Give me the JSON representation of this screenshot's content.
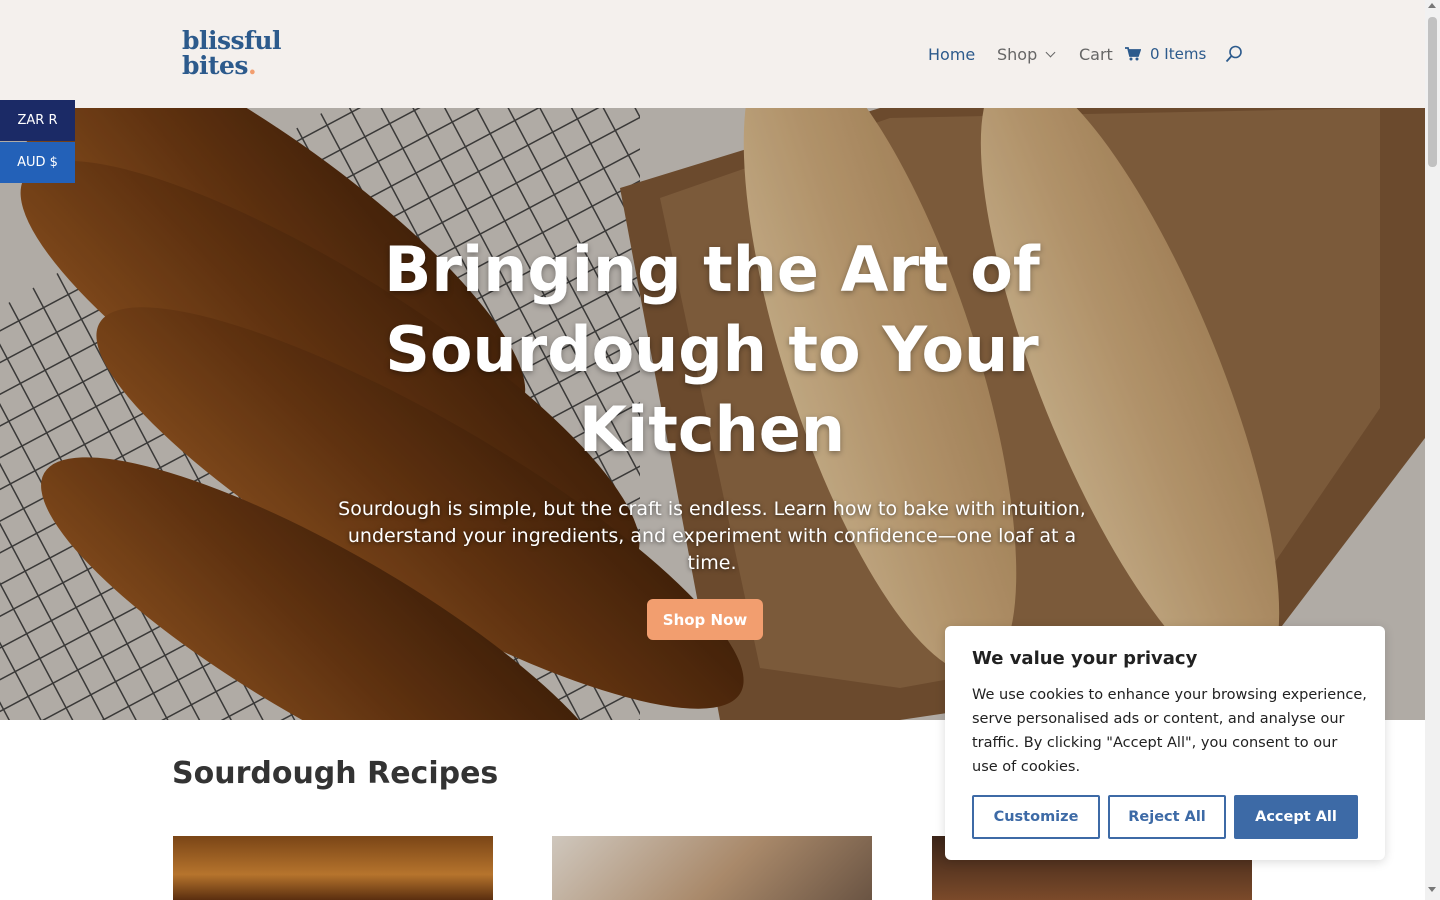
{
  "logo": {
    "line1": "blissful",
    "line2": "bites",
    "dot": "."
  },
  "nav": {
    "home": "Home",
    "shop": "Shop",
    "cart": "Cart",
    "cart_count": "0 Items"
  },
  "currency": {
    "zar": "ZAR R",
    "aud": "AUD $"
  },
  "hero": {
    "title": "Bringing the Art of Sourdough to Your Kitchen",
    "subtitle": "Sourdough is simple, but the craft is endless. Learn how to bake with intuition, understand your ingredients, and experiment with confidence—one loaf at a time.",
    "button": "Shop Now"
  },
  "recipes": {
    "title": "Sourdough Recipes"
  },
  "cookie": {
    "title": "We value your privacy",
    "text": "We use cookies to enhance your browsing experience, serve personalised ads or content, and analyse our traffic. By clicking \"Accept All\", you consent to our use of cookies.",
    "customize": "Customize",
    "reject": "Reject All",
    "accept": "Accept All"
  },
  "colors": {
    "brand": "#2c5a8c",
    "accent": "#f29e6f",
    "cookie_button": "#3d6aa6"
  },
  "icons": [
    "cart-icon",
    "search-icon",
    "chevron-down-icon"
  ]
}
